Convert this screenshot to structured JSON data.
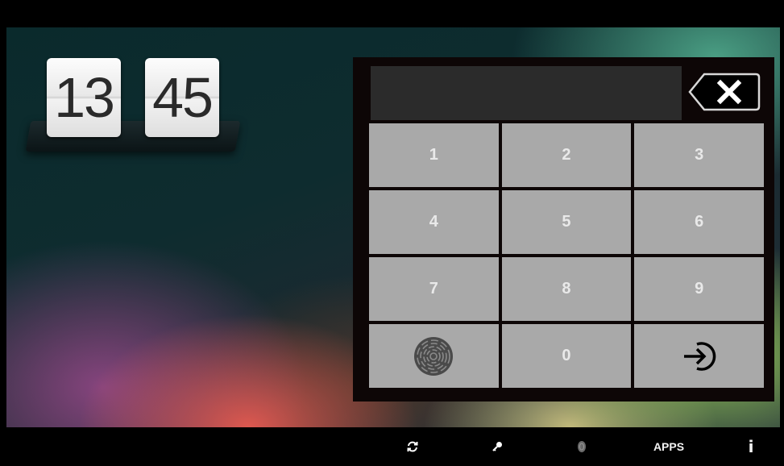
{
  "clock": {
    "hours": "13",
    "minutes": "45"
  },
  "keypad": {
    "display_value": "",
    "keys": [
      "1",
      "2",
      "3",
      "4",
      "5",
      "6",
      "7",
      "8",
      "9",
      "0"
    ],
    "fingerprint_icon": "fingerprint-icon",
    "enter_icon": "login-arrow-icon",
    "backspace_icon": "backspace-x-icon"
  },
  "bottom_bar": {
    "items": [
      {
        "icon": "refresh-icon"
      },
      {
        "icon": "key-icon"
      },
      {
        "icon": "fingerprint-icon"
      },
      {
        "label": "APPS"
      },
      {
        "label": "i"
      }
    ]
  },
  "colors": {
    "key_bg": "#a9a9a9",
    "key_text": "#e9e9e9",
    "panel_bg": "#0d0606",
    "display_bg": "#2b2b2b"
  }
}
